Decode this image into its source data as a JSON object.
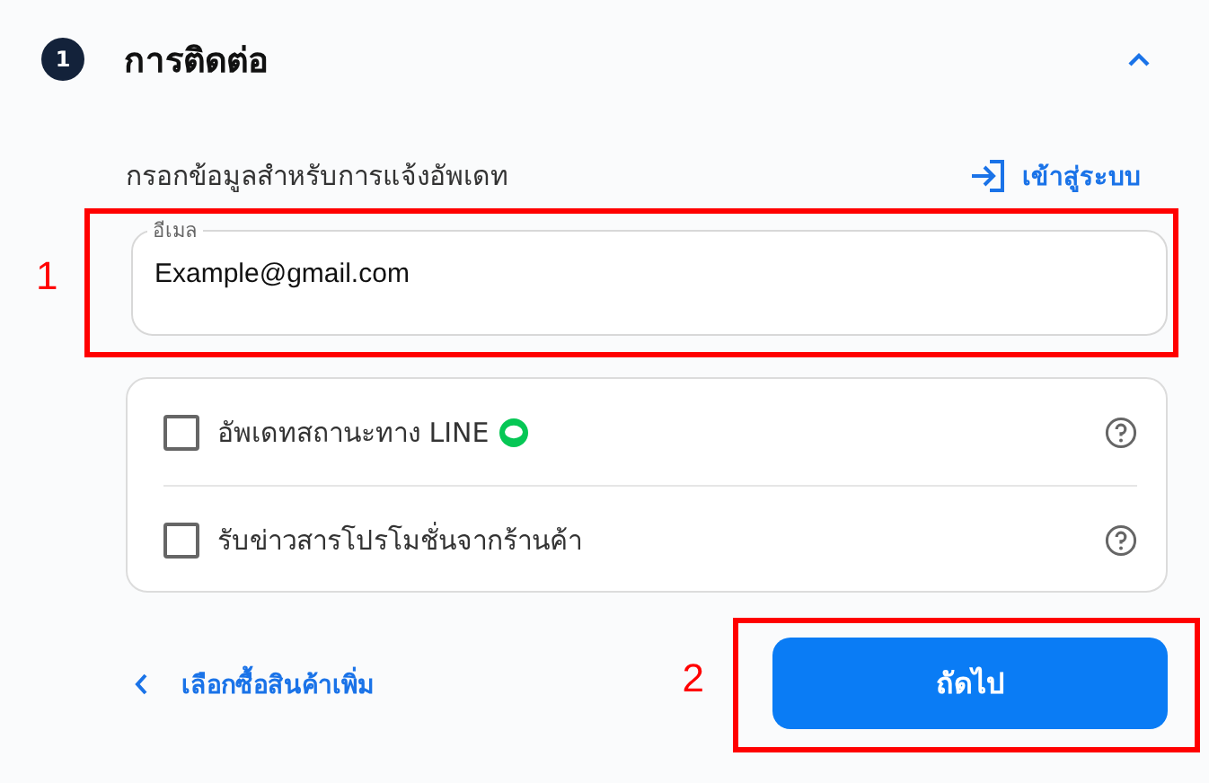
{
  "section": {
    "step": "1",
    "title": "การติดต่อ",
    "expanded": true
  },
  "intro": "กรอกข้อมูลสำหรับการแจ้งอัพเดท",
  "login_link": "เข้าสู่ระบบ",
  "email": {
    "label": "อีเมล",
    "value": "Example@gmail.com"
  },
  "options": [
    {
      "kind": "line",
      "label": "อัพเดทสถานะทาง LINE",
      "checked": false
    },
    {
      "kind": "plain",
      "label": "รับข่าวสารโปรโมชั่นจากร้านค้า",
      "checked": false
    }
  ],
  "back_link": "เลือกซื้อสินค้าเพิ่ม",
  "next_button": "ถัดไป",
  "annotations": [
    {
      "number": "1"
    },
    {
      "number": "2"
    }
  ]
}
